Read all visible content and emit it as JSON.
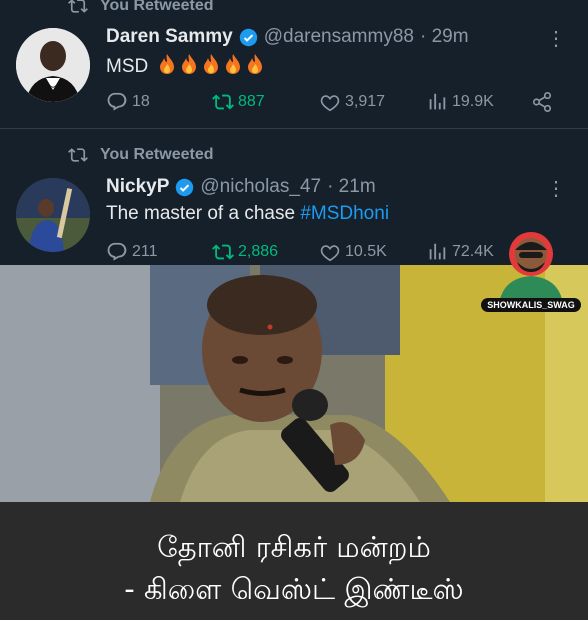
{
  "tweets": [
    {
      "retweet_label": "You Retweeted",
      "name": "Daren Sammy",
      "handle": "@darensammy88",
      "time": "· 29m",
      "text": "MSD",
      "emoji_icon": "fire-emoji",
      "emoji_count": 5,
      "replies": "18",
      "retweets": "887",
      "likes": "3,917",
      "views": "19.9K"
    },
    {
      "retweet_label": "You Retweeted",
      "name": "NickyP",
      "handle": "@nicholas_47",
      "time": "· 21m",
      "text": "The master of a chase",
      "hashtag": "#MSDhoni",
      "replies": "211",
      "retweets": "2,886",
      "likes": "10.5K",
      "views": "72.4K"
    }
  ],
  "meme": {
    "watermark": "SHOWKALIS_SWAG",
    "caption_line1": "தோனி ரசிகர் மன்றம்",
    "caption_line2": "- கிளை வெஸ்ட் இண்டீஸ்"
  },
  "colors": {
    "background": "#15202b",
    "text": "#e7e9ea",
    "muted": "#8b98a5",
    "verified": "#1d9bf0",
    "retweeted": "#00ba7c",
    "hashtag": "#1d9bf0"
  }
}
